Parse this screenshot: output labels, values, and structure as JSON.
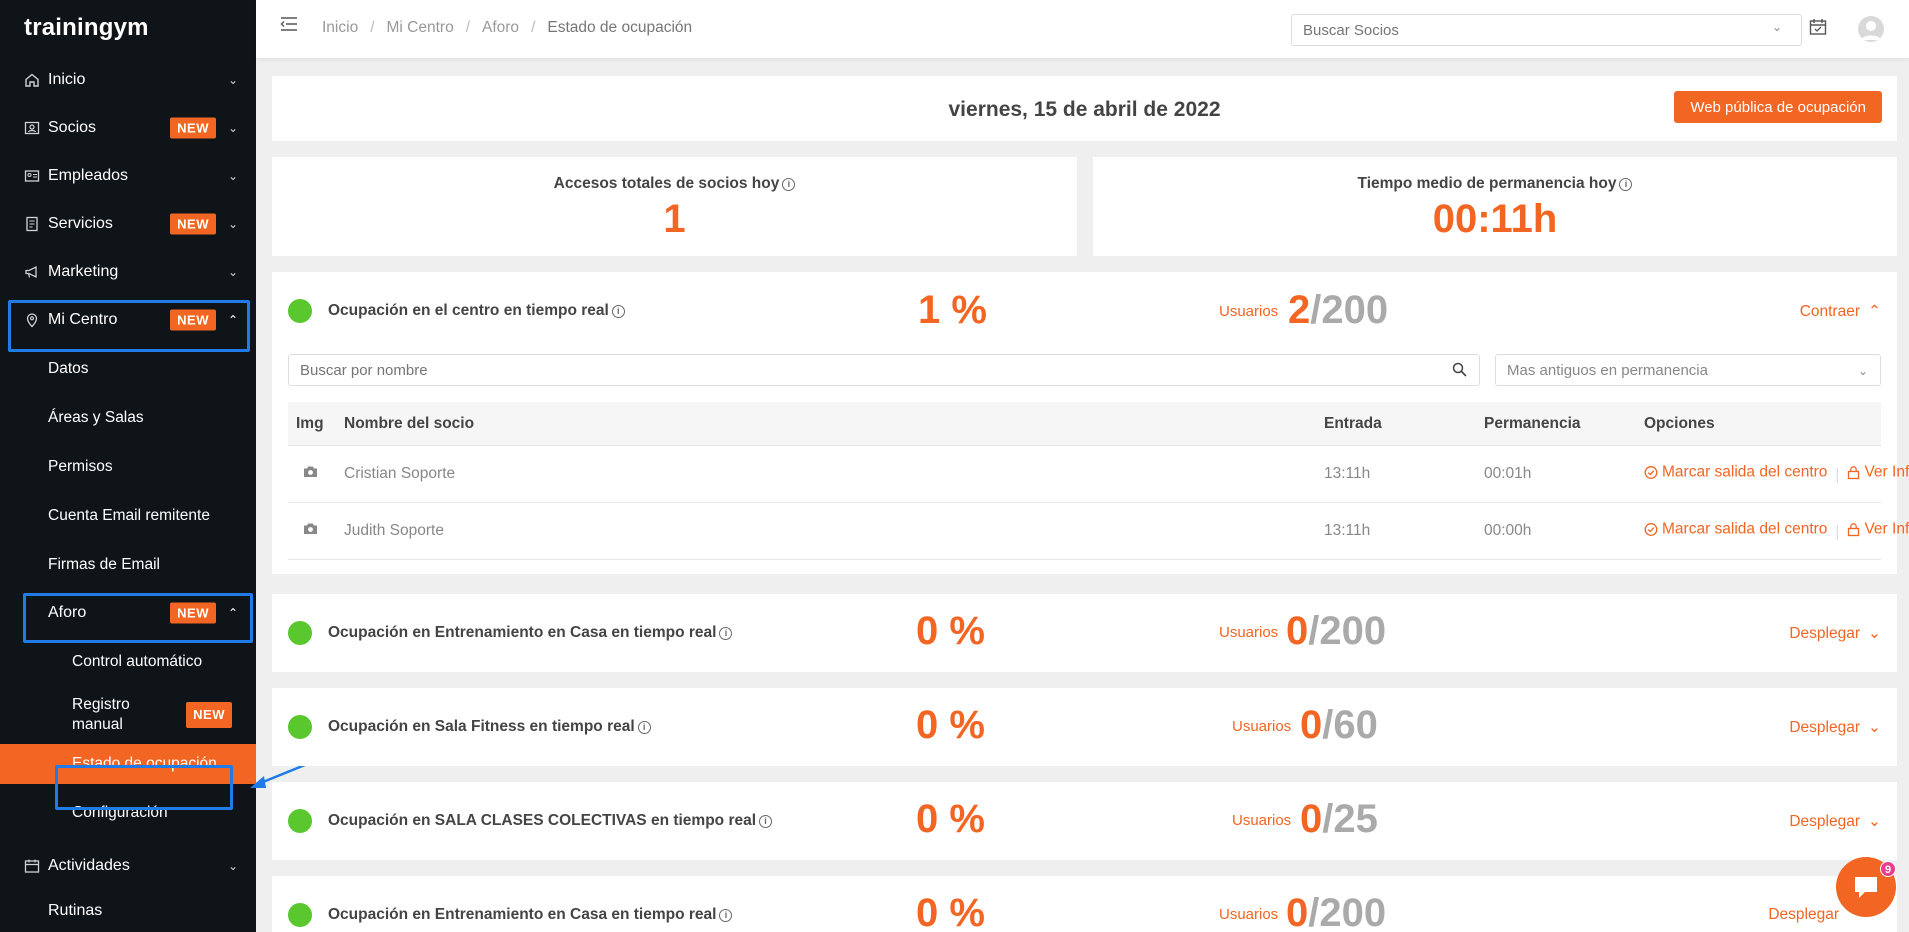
{
  "app": {
    "logo": "trainingym"
  },
  "sidebar": {
    "items": [
      {
        "label": "Inicio",
        "icon": "home-icon"
      },
      {
        "label": "Socios",
        "icon": "members-icon",
        "badge": "NEW"
      },
      {
        "label": "Empleados",
        "icon": "employees-icon"
      },
      {
        "label": "Servicios",
        "icon": "services-icon",
        "badge": "NEW"
      },
      {
        "label": "Marketing",
        "icon": "megaphone-icon"
      },
      {
        "label": "Mi Centro",
        "icon": "location-pin-icon",
        "badge": "NEW"
      }
    ],
    "mi_centro_sub": [
      "Datos",
      "Áreas y Salas",
      "Permisos",
      "Cuenta Email remitente",
      "Firmas de Email"
    ],
    "aforo": {
      "label": "Aforo",
      "badge": "NEW"
    },
    "aforo_sub": {
      "control": "Control automático",
      "registro": "Registro manual",
      "registro_badge": "NEW",
      "estado": "Estado de ocupación",
      "config": "Configuración"
    },
    "actividades": {
      "label": "Actividades",
      "icon": "calendar-icon"
    },
    "rutinas": {
      "label": "Rutinas"
    }
  },
  "header": {
    "breadcrumb": [
      "Inicio",
      "Mi Centro",
      "Aforo",
      "Estado de ocupación"
    ],
    "search_placeholder": "Buscar Socios"
  },
  "main": {
    "date": "viernes, 15 de abril de 2022",
    "web_button": "Web pública de ocupación",
    "stats": [
      {
        "label": "Accesos totales de socios hoy",
        "value": "1"
      },
      {
        "label": "Tiempo medio de permanencia hoy",
        "value": "00:11h"
      }
    ],
    "occupancy": [
      {
        "title": "Ocupación en el centro en tiempo real",
        "pct": "1 %",
        "users_label": "Usuarios",
        "current": "2",
        "capacity": "/200",
        "toggle": "Contraer",
        "expanded": true
      },
      {
        "title": "Ocupación en Entrenamiento en Casa en tiempo real",
        "pct": "0 %",
        "users_label": "Usuarios",
        "current": "0",
        "capacity": "/200",
        "toggle": "Desplegar"
      },
      {
        "title": "Ocupación en Sala Fitness en tiempo real",
        "pct": "0 %",
        "users_label": "Usuarios",
        "current": "0",
        "capacity": "/60",
        "toggle": "Desplegar"
      },
      {
        "title": "Ocupación en SALA CLASES COLECTIVAS en tiempo real",
        "pct": "0 %",
        "users_label": "Usuarios",
        "current": "0",
        "capacity": "/25",
        "toggle": "Desplegar"
      },
      {
        "title": "Ocupación en Entrenamiento en Casa en tiempo real",
        "pct": "0 %",
        "users_label": "Usuarios",
        "current": "0",
        "capacity": "/200",
        "toggle": "Desplegar"
      }
    ],
    "name_search_placeholder": "Buscar por nombre",
    "order_select": "Mas antiguos en permanencia",
    "table": {
      "headers": [
        "Img",
        "Nombre del socio",
        "Entrada",
        "Permanencia",
        "Opciones"
      ],
      "rows": [
        {
          "name": "Cristian Soporte",
          "entrada": "13:11h",
          "permanencia": "00:01h"
        },
        {
          "name": "Judith Soporte",
          "entrada": "13:11h",
          "permanencia": "00:00h"
        }
      ],
      "action_exit": "Marcar salida del centro",
      "action_info": "Ver Info"
    }
  },
  "chat": {
    "count": "9"
  },
  "colors": {
    "accent": "#f26522",
    "sidebar_bg": "#0f1419",
    "status_green": "#5ac72e",
    "highlight": "#1e7be8"
  }
}
